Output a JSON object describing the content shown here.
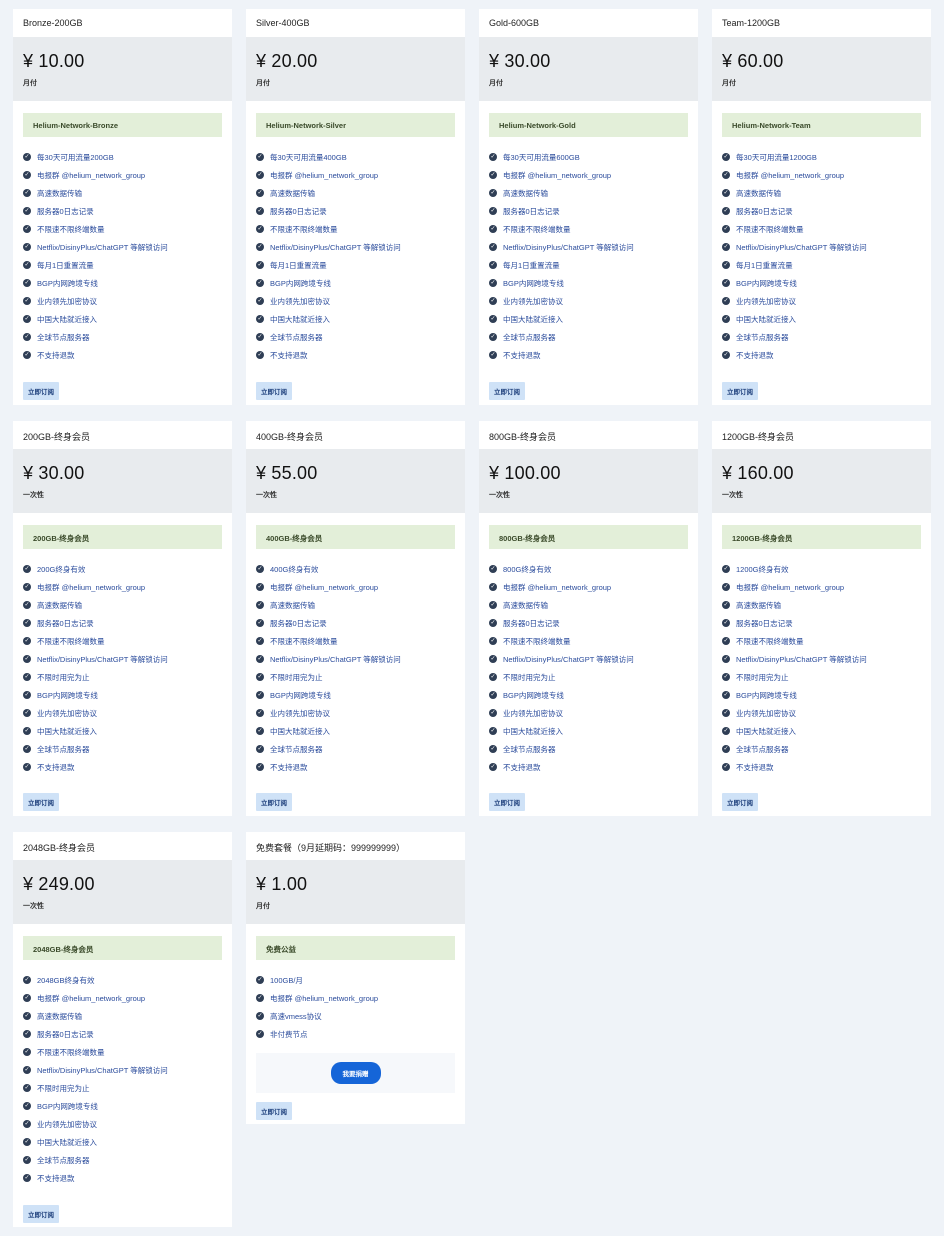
{
  "cards": [
    {
      "title": "Bronze-200GB",
      "price": "¥ 10.00",
      "period": "月付",
      "plan": "Helium-Network-Bronze",
      "features": [
        "每30天可用流量200GB",
        "电报群 @helium_network_group",
        "高速数据传输",
        "服务器0日志记录",
        "不限速不限终端数量",
        "Netflix/DisinyPlus/ChatGPT 等解锁访问",
        "每月1日重置流量",
        "BGP内网跨境专线",
        "业内领先加密协议",
        "中国大陆就近接入",
        "全球节点服务器",
        "不支持退款"
      ],
      "subscribe": "立即订阅"
    },
    {
      "title": "Silver-400GB",
      "price": "¥ 20.00",
      "period": "月付",
      "plan": "Helium-Network-Silver",
      "features": [
        "每30天可用流量400GB",
        "电报群 @helium_network_group",
        "高速数据传输",
        "服务器0日志记录",
        "不限速不限终端数量",
        "Netflix/DisinyPlus/ChatGPT 等解锁访问",
        "每月1日重置流量",
        "BGP内网跨境专线",
        "业内领先加密协议",
        "中国大陆就近接入",
        "全球节点服务器",
        "不支持退款"
      ],
      "subscribe": "立即订阅"
    },
    {
      "title": "Gold-600GB",
      "price": "¥ 30.00",
      "period": "月付",
      "plan": "Helium-Network-Gold",
      "features": [
        "每30天可用流量600GB",
        "电报群 @helium_network_group",
        "高速数据传输",
        "服务器0日志记录",
        "不限速不限终端数量",
        "Netflix/DisinyPlus/ChatGPT 等解锁访问",
        "每月1日重置流量",
        "BGP内网跨境专线",
        "业内领先加密协议",
        "中国大陆就近接入",
        "全球节点服务器",
        "不支持退款"
      ],
      "subscribe": "立即订阅"
    },
    {
      "title": "Team-1200GB",
      "price": "¥ 60.00",
      "period": "月付",
      "plan": "Helium-Network-Team",
      "features": [
        "每30天可用流量1200GB",
        "电报群 @helium_network_group",
        "高速数据传输",
        "服务器0日志记录",
        "不限速不限终端数量",
        "Netflix/DisinyPlus/ChatGPT 等解锁访问",
        "每月1日重置流量",
        "BGP内网跨境专线",
        "业内领先加密协议",
        "中国大陆就近接入",
        "全球节点服务器",
        "不支持退款"
      ],
      "subscribe": "立即订阅"
    },
    {
      "title": "200GB-终身会员",
      "price": "¥ 30.00",
      "period": "一次性",
      "plan": "200GB-终身会员",
      "features": [
        "200G终身有效",
        "电报群 @helium_network_group",
        "高速数据传输",
        "服务器0日志记录",
        "不限速不限终端数量",
        "Netflix/DisinyPlus/ChatGPT 等解锁访问",
        "不限时用完为止",
        "BGP内网跨境专线",
        "业内领先加密协议",
        "中国大陆就近接入",
        "全球节点服务器",
        "不支持退款"
      ],
      "subscribe": "立即订阅"
    },
    {
      "title": "400GB-终身会员",
      "price": "¥ 55.00",
      "period": "一次性",
      "plan": "400GB-终身会员",
      "features": [
        "400G终身有效",
        "电报群 @helium_network_group",
        "高速数据传输",
        "服务器0日志记录",
        "不限速不限终端数量",
        "Netflix/DisinyPlus/ChatGPT 等解锁访问",
        "不限时用完为止",
        "BGP内网跨境专线",
        "业内领先加密协议",
        "中国大陆就近接入",
        "全球节点服务器",
        "不支持退款"
      ],
      "subscribe": "立即订阅"
    },
    {
      "title": "800GB-终身会员",
      "price": "¥ 100.00",
      "period": "一次性",
      "plan": "800GB-终身会员",
      "features": [
        "800G终身有效",
        "电报群 @helium_network_group",
        "高速数据传输",
        "服务器0日志记录",
        "不限速不限终端数量",
        "Netflix/DisinyPlus/ChatGPT 等解锁访问",
        "不限时用完为止",
        "BGP内网跨境专线",
        "业内领先加密协议",
        "中国大陆就近接入",
        "全球节点服务器",
        "不支持退款"
      ],
      "subscribe": "立即订阅"
    },
    {
      "title": "1200GB-终身会员",
      "price": "¥ 160.00",
      "period": "一次性",
      "plan": "1200GB-终身会员",
      "features": [
        "1200G终身有效",
        "电报群 @helium_network_group",
        "高速数据传输",
        "服务器0日志记录",
        "不限速不限终端数量",
        "Netflix/DisinyPlus/ChatGPT 等解锁访问",
        "不限时用完为止",
        "BGP内网跨境专线",
        "业内领先加密协议",
        "中国大陆就近接入",
        "全球节点服务器",
        "不支持退款"
      ],
      "subscribe": "立即订阅"
    },
    {
      "title": "2048GB-终身会员",
      "price": "¥ 249.00",
      "period": "一次性",
      "plan": "2048GB-终身会员",
      "features": [
        "2048GB终身有效",
        "电报群 @helium_network_group",
        "高速数据传输",
        "服务器0日志记录",
        "不限速不限终端数量",
        "Netflix/DisinyPlus/ChatGPT 等解锁访问",
        "不限时用完为止",
        "BGP内网跨境专线",
        "业内领先加密协议",
        "中国大陆就近接入",
        "全球节点服务器",
        "不支持退款"
      ],
      "subscribe": "立即订阅"
    },
    {
      "title": "免费套餐（9月延期码：999999999）",
      "price": "¥ 1.00",
      "period": "月付",
      "plan": "免费公益",
      "features": [
        "100GB/月",
        "电报群 @helium_network_group",
        "高速vmess协议",
        "非付费节点"
      ],
      "donate": "我要捐赠",
      "subscribe": "立即订阅"
    }
  ]
}
